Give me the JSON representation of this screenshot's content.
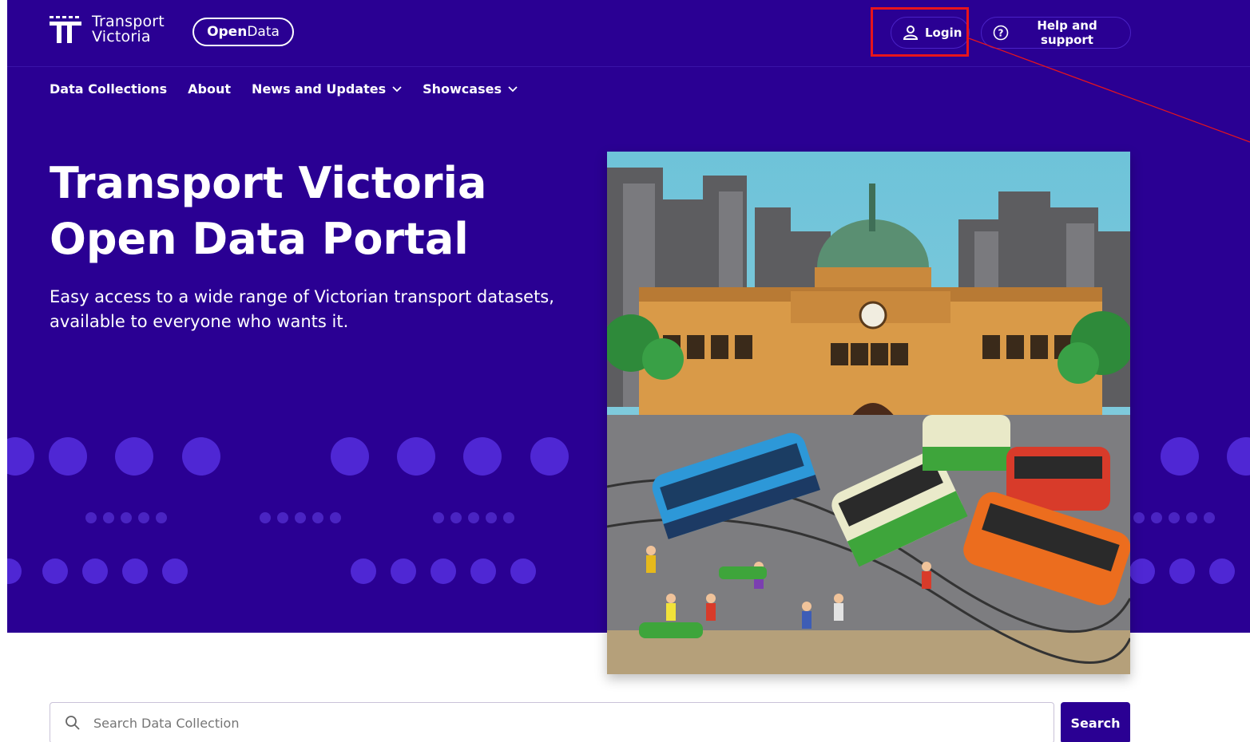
{
  "brand": {
    "name_line1": "Transport",
    "name_line2": "Victoria",
    "opendata_bold": "Open",
    "opendata_regular": "Data"
  },
  "header": {
    "login_label": "Login",
    "help_label": "Help and support"
  },
  "nav": {
    "items": [
      {
        "label": "Data Collections",
        "has_dropdown": false
      },
      {
        "label": "About",
        "has_dropdown": false
      },
      {
        "label": "News and Updates",
        "has_dropdown": true
      },
      {
        "label": "Showcases",
        "has_dropdown": true
      }
    ]
  },
  "hero": {
    "title_line1": "Transport Victoria",
    "title_line2": "Open Data Portal",
    "subtitle_line1": "Easy access to a wide range of Victorian transport datasets,",
    "subtitle_line2": "available to everyone who wants it."
  },
  "search": {
    "placeholder": "Search Data Collection",
    "button_label": "Search"
  },
  "colors": {
    "primary": "#2a0093",
    "accent_dot": "#4f27d4",
    "highlight": "#e8141c"
  }
}
